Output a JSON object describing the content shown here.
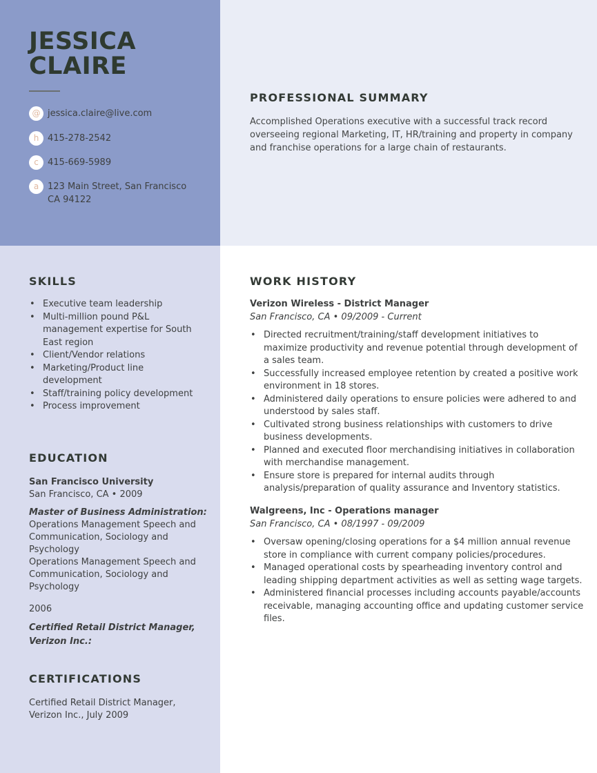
{
  "header": {
    "first_name": "JESSICA",
    "last_name": "CLAIRE"
  },
  "contact": [
    {
      "icon": "@",
      "icon_name": "email-icon",
      "text": "jessica.claire@live.com"
    },
    {
      "icon": "h",
      "icon_name": "home-phone-icon",
      "text": "415-278-2542"
    },
    {
      "icon": "c",
      "icon_name": "cell-phone-icon",
      "text": "415-669-5989"
    },
    {
      "icon": "a",
      "icon_name": "address-icon",
      "text": "123 Main Street, San Francisco CA 94122"
    }
  ],
  "summary": {
    "title": "PROFESSIONAL SUMMARY",
    "text": "Accomplished Operations executive with a successful track record overseeing regional Marketing, IT, HR/training and property in company and franchise operations for a large chain of restaurants."
  },
  "skills": {
    "title": "SKILLS",
    "items": [
      "Executive team leadership",
      "Multi-million pound P&L management expertise for South East region",
      "Client/Vendor relations",
      "Marketing/Product line development",
      "Staff/training policy development",
      "Process improvement"
    ]
  },
  "education": {
    "title": "EDUCATION",
    "school": "San Francisco University",
    "location": "San Francisco, CA • 2009",
    "degree": "Master of Business Administration:",
    "details_1": "Operations Management Speech and Communication, Sociology and Psychology",
    "details_2": "Operations Management Speech and Communication, Sociology and Psychology",
    "year": "2006",
    "cert_heading": "Certified Retail District Manager, Verizon Inc.:"
  },
  "certifications": {
    "title": "CERTIFICATIONS",
    "text": "Certified Retail District Manager, Verizon Inc., July 2009"
  },
  "work_history": {
    "title": "WORK HISTORY",
    "jobs": [
      {
        "title": "Verizon Wireless - District Manager",
        "meta": "San Francisco, CA • 09/2009 - Current",
        "bullets": [
          "Directed recruitment/training/staff development initiatives to maximize productivity and revenue potential through development of a sales team.",
          "Successfully increased employee retention by created a positive work environment in 18 stores.",
          "Administered daily operations to ensure policies were adhered to and understood by sales staff.",
          "Cultivated strong business relationships with customers to drive business developments.",
          "Planned and executed floor merchandising initiatives in collaboration with merchandise management.",
          "Ensure store is prepared for internal audits through analysis/preparation of quality assurance and Inventory statistics."
        ]
      },
      {
        "title": "Walgreens, Inc - Operations manager",
        "meta": "San Francisco, CA • 08/1997 - 09/2009",
        "bullets": [
          "Oversaw opening/closing operations for a $4 million annual revenue store in compliance with current company policies/procedures.",
          "Managed operational costs by spearheading inventory control and leading shipping department activities as well as setting wage targets.",
          "Administered financial processes including accounts payable/accounts receivable, managing accounting office and updating customer service files."
        ]
      }
    ]
  },
  "colors": {
    "sidebar_top": "#8b9bc9",
    "sidebar_bottom": "#d9dcee",
    "header_right": "#eaedf6",
    "icon_text": "#e0b8a0",
    "name_text": "#2f3a30"
  }
}
